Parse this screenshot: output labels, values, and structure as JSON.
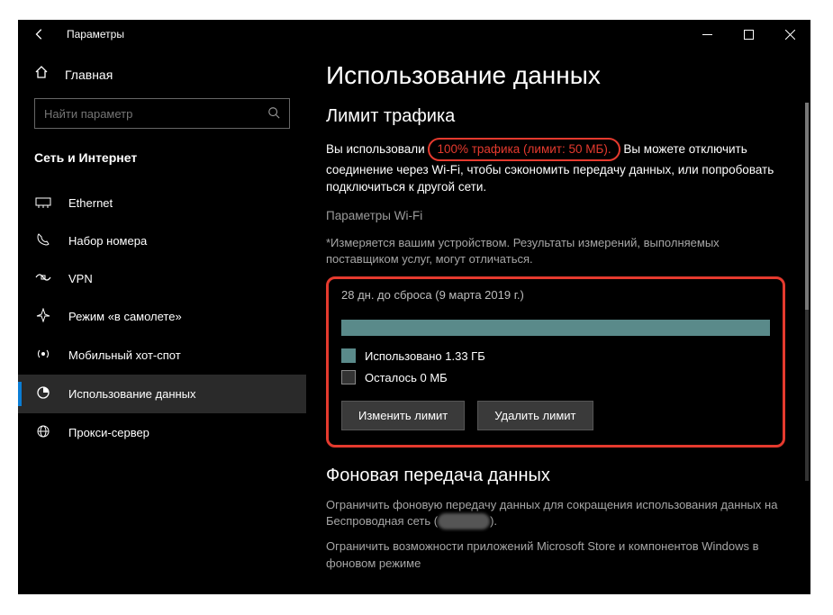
{
  "titlebar": {
    "title": "Параметры"
  },
  "sidebar": {
    "home": "Главная",
    "search_placeholder": "Найти параметр",
    "section": "Сеть и Интернет",
    "items": [
      {
        "label": "Ethernet"
      },
      {
        "label": "Набор номера"
      },
      {
        "label": "VPN"
      },
      {
        "label": "Режим «в самолете»"
      },
      {
        "label": "Мобильный хот-спот"
      },
      {
        "label": "Использование данных"
      },
      {
        "label": "Прокси-сервер"
      }
    ]
  },
  "content": {
    "page_title": "Использование данных",
    "section_title": "Лимит трафика",
    "desc_pre": "Вы использовали ",
    "traffic_highlight": "100% трафика (лимит: 50 МБ).",
    "desc_post": " Вы можете отключить соединение через Wi-Fi, чтобы сэкономить передачу данных, или попробовать подключиться к другой сети.",
    "wifi_link": "Параметры Wi-Fi",
    "note": "*Измеряется вашим устройством. Результаты измерений, выполняемых поставщиком услуг, могут отличаться.",
    "reset_line": "28 дн. до сброса (9 марта 2019 г.)",
    "used_label": "Использовано 1.33 ГБ",
    "remaining_label": "Осталось 0 МБ",
    "change_btn": "Изменить лимит",
    "delete_btn": "Удалить лимит",
    "bg_title": "Фоновая передача данных",
    "bg_desc_1": "Ограничить фоновую передачу данных для сокращения использования данных на Беспроводная сеть (",
    "bg_desc_1b": ").",
    "bg_desc_2": "Ограничить возможности приложений Microsoft Store и компонентов Windows в фоновом режиме"
  },
  "colors": {
    "used": "#5a8a8a",
    "accent": "#0a7dd5",
    "highlight": "#e53a2e"
  }
}
